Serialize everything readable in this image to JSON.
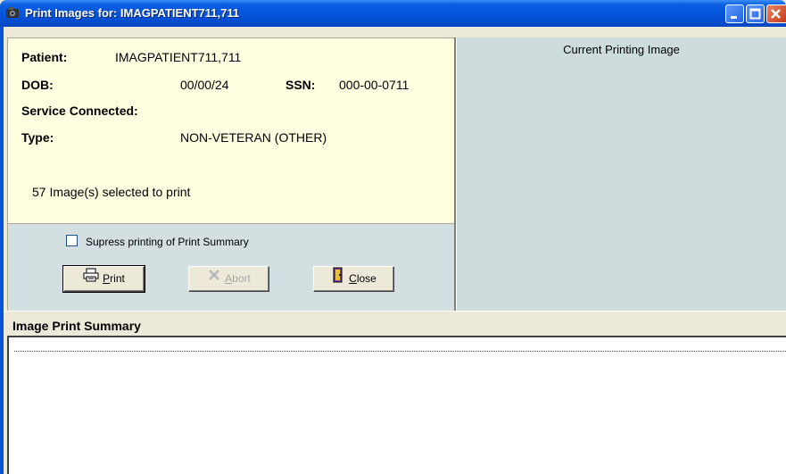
{
  "window": {
    "title": "Print Images for: IMAGPATIENT711,711"
  },
  "patient": {
    "name_label": "Patient:",
    "name": "IMAGPATIENT711,711",
    "dob_label": "DOB:",
    "dob": "00/00/24",
    "ssn_label": "SSN:",
    "ssn": "000-00-0711",
    "service_connected_label": "Service Connected:",
    "type_label": "Type:",
    "type": "NON-VETERAN (OTHER)"
  },
  "selection_status": "57 Image(s) selected to print",
  "options": {
    "suppress_label": "Supress printing of Print Summary",
    "suppress_checked": false
  },
  "buttons": {
    "print_label": "rint",
    "print_hotkey": "P",
    "abort_label": "bort",
    "abort_hotkey": "A",
    "close_label": "lose",
    "close_hotkey": "C"
  },
  "image_panel": {
    "header": "Current Printing Image"
  },
  "summary": {
    "header": "Image Print Summary"
  }
}
